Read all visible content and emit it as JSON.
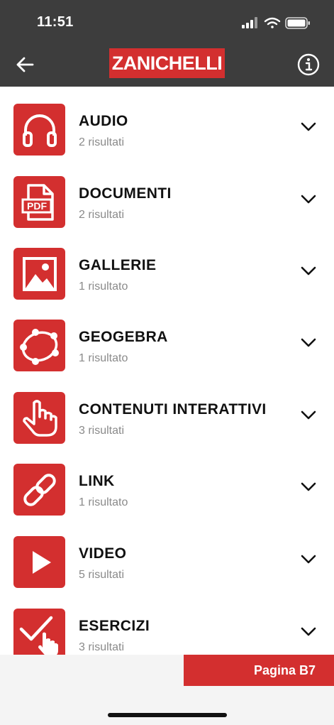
{
  "status": {
    "time": "11:51"
  },
  "header": {
    "brand": "ZANICHELLI",
    "back_icon": "arrow-left-icon",
    "info_icon": "info-icon"
  },
  "colors": {
    "accent": "#d32f2f",
    "header_bg": "#3d3d3d"
  },
  "items": [
    {
      "title": "AUDIO",
      "count": "2 risultati",
      "icon": "headphones-icon"
    },
    {
      "title": "DOCUMENTI",
      "count": "2 risultati",
      "icon": "pdf-icon"
    },
    {
      "title": "GALLERIE",
      "count": "1 risultato",
      "icon": "gallery-icon"
    },
    {
      "title": "GEOGEBRA",
      "count": "1 risultato",
      "icon": "geogebra-icon"
    },
    {
      "title": "CONTENUTI INTERATTIVI",
      "count": "3 risultati",
      "icon": "hand-pointer-icon"
    },
    {
      "title": "LINK",
      "count": "1 risultato",
      "icon": "link-icon"
    },
    {
      "title": "VIDEO",
      "count": "5 risultati",
      "icon": "play-icon"
    },
    {
      "title": "ESERCIZI",
      "count": "3 risultati",
      "icon": "checkmark-hand-icon"
    }
  ],
  "page_button": {
    "label": "Pagina B7"
  }
}
